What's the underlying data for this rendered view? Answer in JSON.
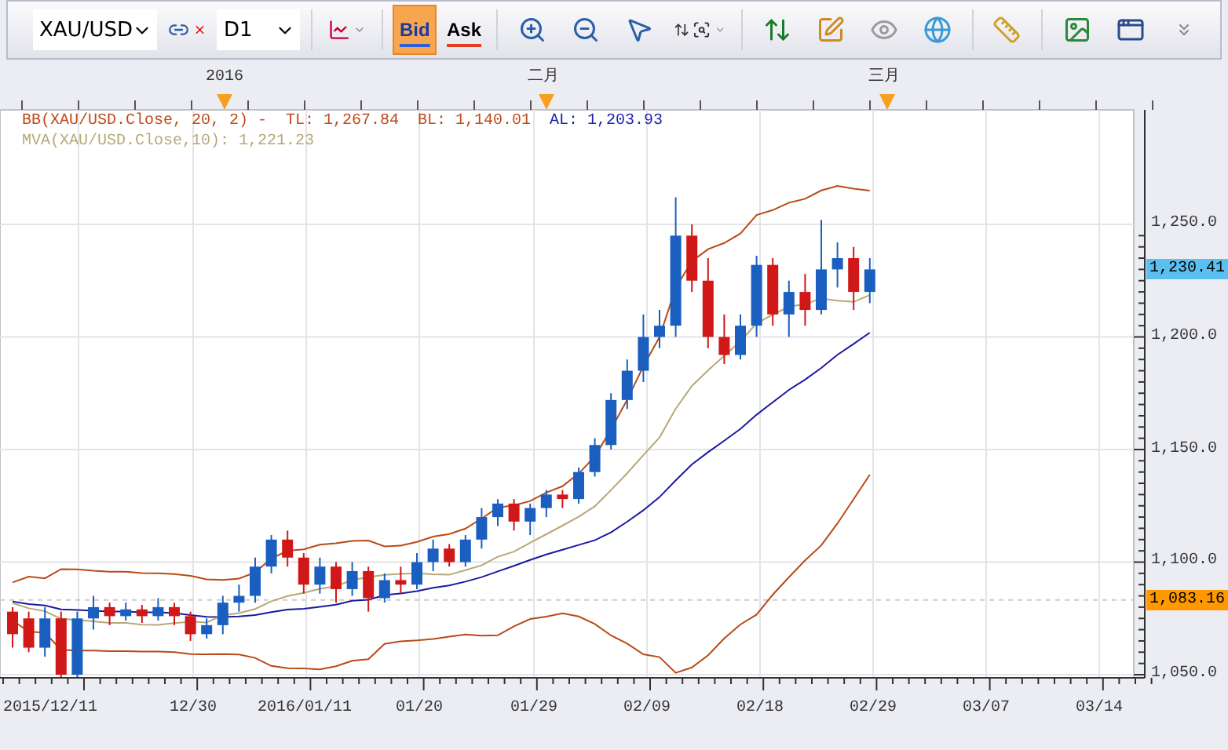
{
  "toolbar": {
    "symbol": "XAU/USD",
    "timeframe": "D1",
    "price_buttons": [
      {
        "label": "Bid",
        "selected": true,
        "kind": "bid"
      },
      {
        "label": "Ask",
        "selected": false,
        "kind": "ask"
      }
    ]
  },
  "timeline": {
    "markers": [
      "2016",
      "二月",
      "三月"
    ]
  },
  "legend": {
    "bb": {
      "label": "BB(XAU/USD.Close, 20, 2) -",
      "top": "TL: 1,267.84",
      "bottom": "BL: 1,140.01",
      "average": "AL: 1,203.93"
    },
    "mva": "MVA(XAU/USD.Close,10): 1,221.23"
  },
  "y_axis": {
    "labels": [
      "1,250.0",
      "1,200.0",
      "1,150.0",
      "1,100.0",
      "1,050.0"
    ]
  },
  "price_tags": [
    {
      "text": "1,230.41",
      "color": "#5bc0f0"
    },
    {
      "text": "1,083.16",
      "color": "#ff9900"
    }
  ],
  "x_axis": {
    "labels": [
      "2015/12/11",
      "12/30",
      "2016/01/11",
      "01/20",
      "01/29",
      "02/09",
      "02/18",
      "02/29",
      "03/07",
      "03/14"
    ]
  }
}
